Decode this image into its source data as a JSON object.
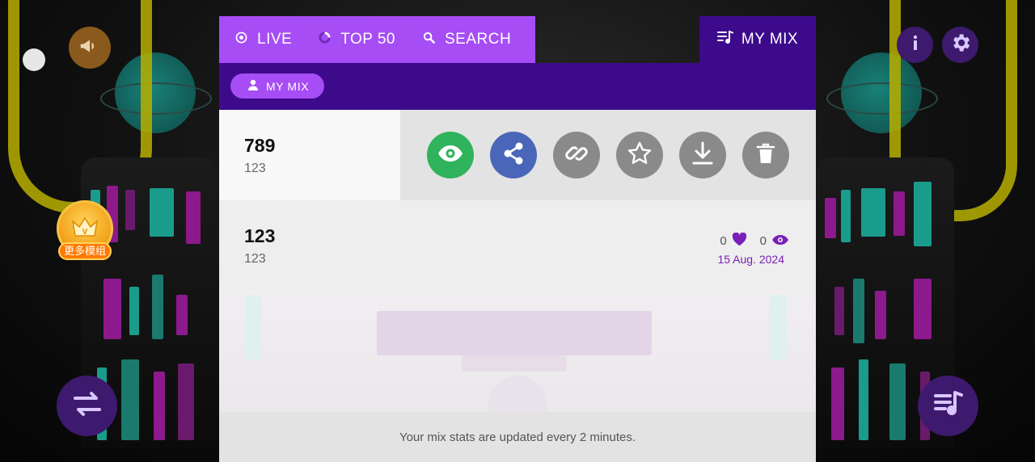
{
  "tabs": [
    {
      "label": "LIVE",
      "icon": "radio-icon"
    },
    {
      "label": "TOP 50",
      "icon": "loading-ring-icon"
    },
    {
      "label": "SEARCH",
      "icon": "search-icon"
    }
  ],
  "mymix_tab": {
    "label": "MY MIX",
    "icon": "playlist-icon"
  },
  "filter_pill": {
    "label": "MY MIX",
    "icon": "user-icon"
  },
  "mixes": [
    {
      "title": "789",
      "subtitle": "123"
    },
    {
      "title": "123",
      "subtitle": "123",
      "likes": "0",
      "views": "0",
      "date": "15 Aug. 2024"
    }
  ],
  "actions": [
    "view-icon",
    "share-icon",
    "link-icon",
    "star-icon",
    "download-icon",
    "trash-icon"
  ],
  "side": {
    "badge_label": "更多模组"
  },
  "footer": {
    "message": "Your mix stats are updated every 2 minutes."
  },
  "colors": {
    "accent": "#a64df5",
    "dark_purple": "#3d0a8c",
    "view_green": "#2fb35c",
    "share_blue": "#4a66b8"
  }
}
